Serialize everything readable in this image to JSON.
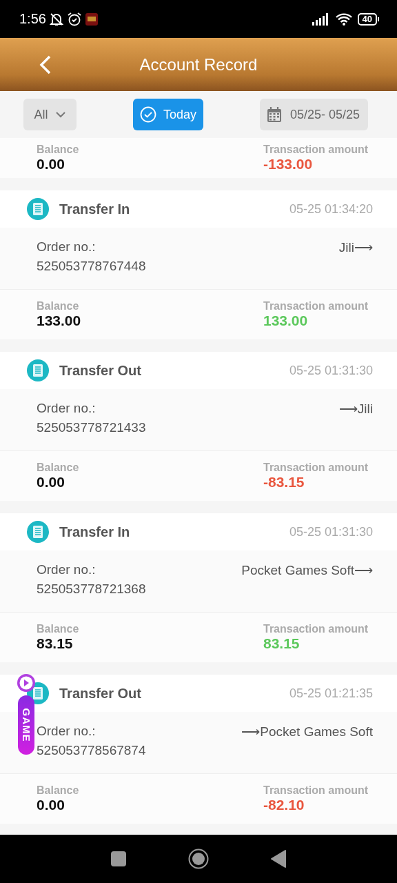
{
  "status_bar": {
    "time": "1:56",
    "battery": "40"
  },
  "header": {
    "title": "Account Record"
  },
  "filters": {
    "type": {
      "value": "All"
    },
    "today": {
      "label": "Today",
      "selected": true
    },
    "date_range": "05/25- 05/25"
  },
  "records": [
    {
      "balance_label": "Balance",
      "balance": "0.00",
      "amount_label": "Transaction amount",
      "amount": "-133.00",
      "kind": "out"
    },
    {
      "title": "Transfer In",
      "time": "05-25 01:34:20",
      "order_label": "Order no.:",
      "order_no": "525053778767448",
      "route": "Jili⟶",
      "balance_label": "Balance",
      "balance": "133.00",
      "amount_label": "Transaction amount",
      "amount": "133.00",
      "kind": "in"
    },
    {
      "title": "Transfer Out",
      "time": "05-25 01:31:30",
      "order_label": "Order no.:",
      "order_no": "525053778721433",
      "route": "⟶Jili",
      "balance_label": "Balance",
      "balance": "0.00",
      "amount_label": "Transaction amount",
      "amount": "-83.15",
      "kind": "out"
    },
    {
      "title": "Transfer In",
      "time": "05-25 01:31:30",
      "order_label": "Order no.:",
      "order_no": "525053778721368",
      "route": "Pocket Games Soft⟶",
      "balance_label": "Balance",
      "balance": "83.15",
      "amount_label": "Transaction amount",
      "amount": "83.15",
      "kind": "in"
    },
    {
      "title": "Transfer Out",
      "time": "05-25 01:21:35",
      "order_label": "Order no.:",
      "order_no": "525053778567874",
      "route": "⟶Pocket Games Soft",
      "balance_label": "Balance",
      "balance": "0.00",
      "amount_label": "Transaction amount",
      "amount": "-82.10",
      "kind": "out"
    }
  ],
  "floating_badge": {
    "label": "GAME"
  }
}
